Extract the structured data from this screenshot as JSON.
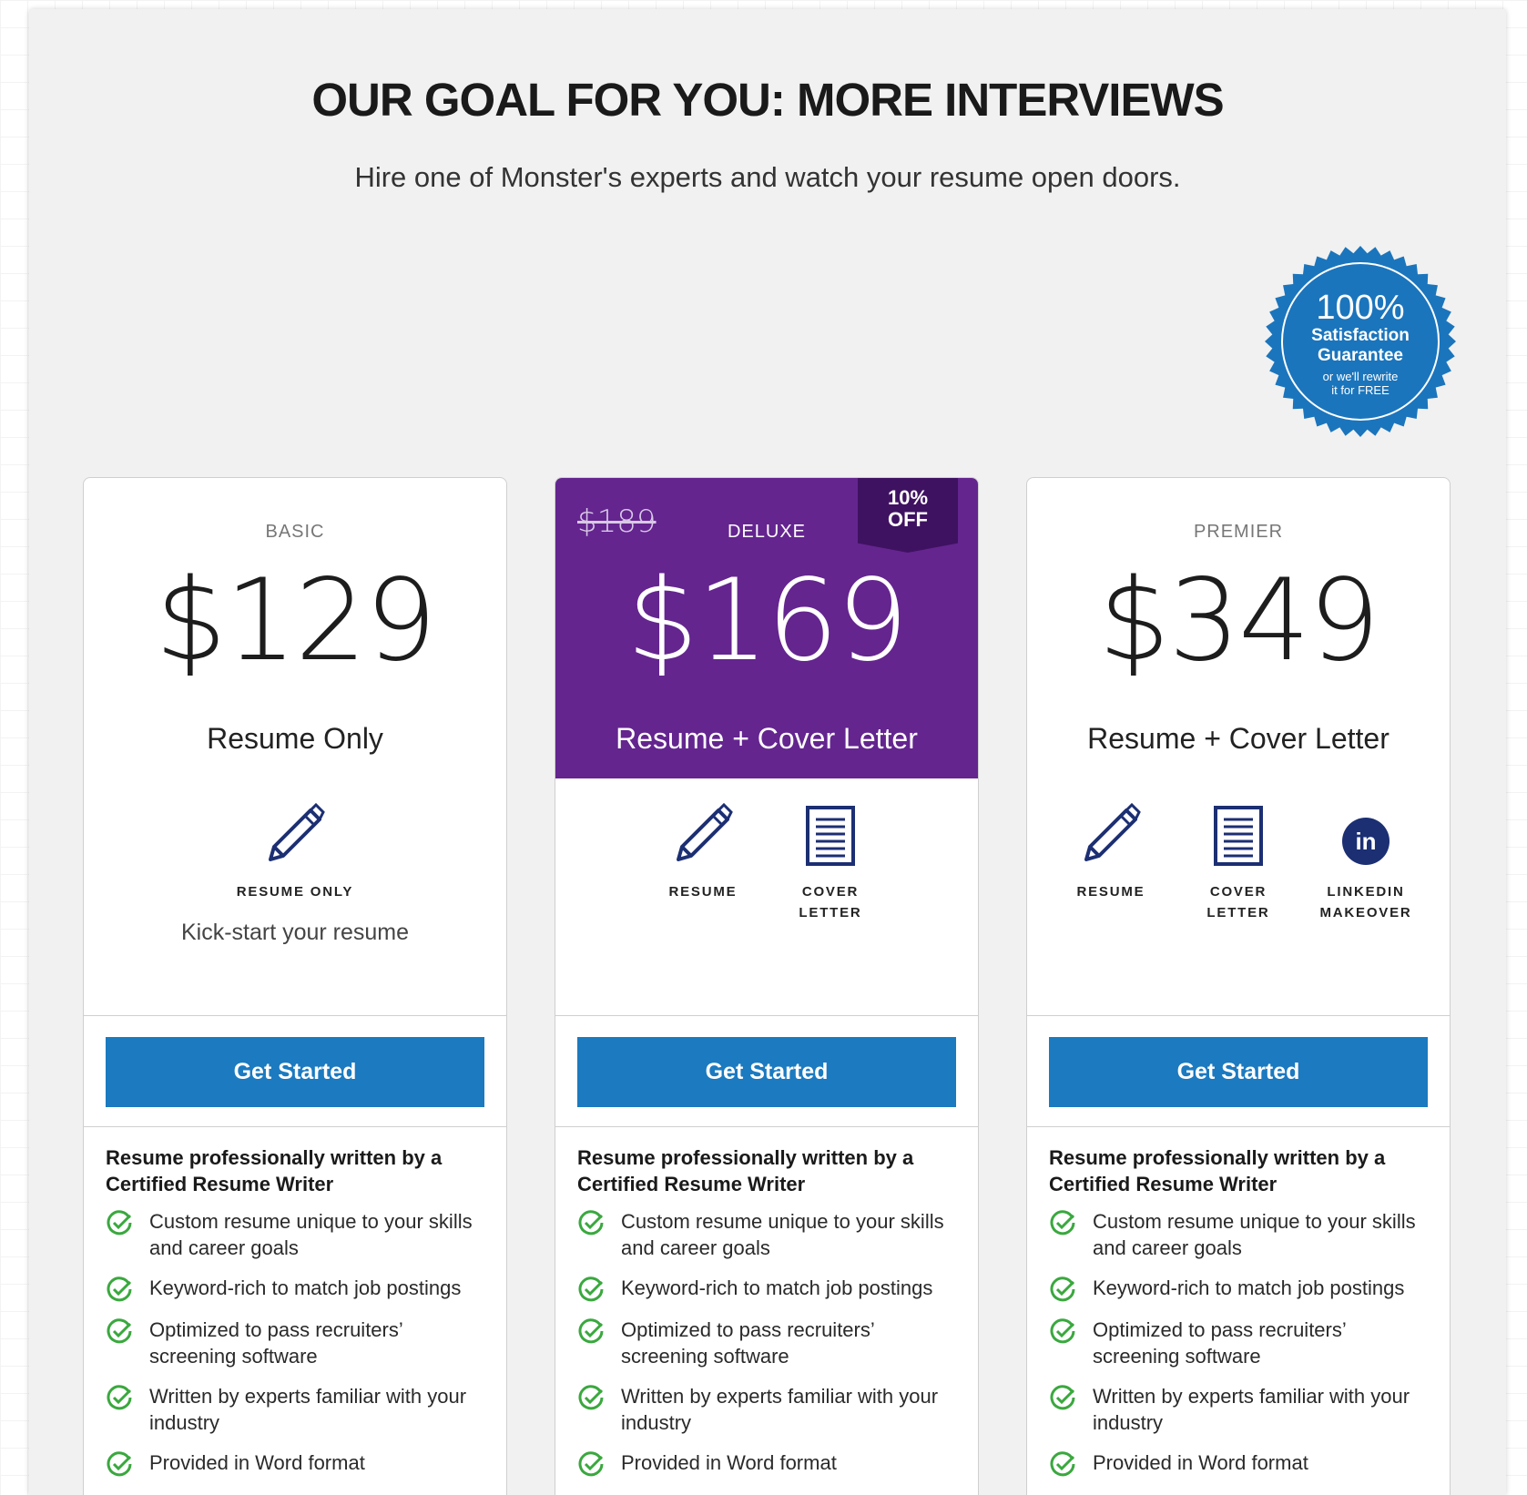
{
  "header": {
    "title": "OUR GOAL FOR YOU: MORE INTERVIEWS",
    "subtitle": "Hire one of Monster's experts and watch your resume open doors."
  },
  "seal": {
    "percent": "100%",
    "line1": "Satisfaction",
    "line2": "Guarantee",
    "small1": "or we'll rewrite",
    "small2": "it for FREE",
    "color": "#1b75bc"
  },
  "colors": {
    "accent_purple": "#64258f",
    "badge_purple": "#3f1261",
    "cta_blue": "#1b7ac0",
    "icon_navy": "#1c2f73",
    "check_green": "#3aa83e"
  },
  "plans": [
    {
      "tier": "BASIC",
      "price": "$129",
      "name": "Resume Only",
      "features": [
        {
          "icon": "pen-icon",
          "label": "RESUME ONLY"
        }
      ],
      "tagline": "Kick-start your resume",
      "cta": "Get Started",
      "list_heading": "Resume professionally written by a Certified Resume Writer",
      "bullets": [
        "Custom resume unique to your skills and career goals",
        "Keyword-rich to match job postings",
        "Optimized to pass recruiters’ screening software",
        "Written by experts familiar with your industry",
        "Provided in Word format"
      ]
    },
    {
      "tier": "DELUXE",
      "old_price": "$189",
      "discount_line1": "10%",
      "discount_line2": "OFF",
      "price": "$169",
      "name": "Resume + Cover Letter",
      "features": [
        {
          "icon": "pen-icon",
          "label_line1": "RESUME",
          "label_line2": ""
        },
        {
          "icon": "document-icon",
          "label_line1": "COVER",
          "label_line2": "LETTER"
        }
      ],
      "cta": "Get Started",
      "list_heading": "Resume professionally written by a Certified Resume Writer",
      "bullets": [
        "Custom resume unique to your skills and career goals",
        "Keyword-rich to match job postings",
        "Optimized to pass recruiters’ screening software",
        "Written by experts familiar with your industry",
        "Provided in Word format"
      ]
    },
    {
      "tier": "PREMIER",
      "price": "$349",
      "name": "Resume + Cover Letter",
      "features": [
        {
          "icon": "pen-icon",
          "label_line1": "RESUME",
          "label_line2": ""
        },
        {
          "icon": "document-icon",
          "label_line1": "COVER",
          "label_line2": "LETTER"
        },
        {
          "icon": "linkedin-icon",
          "label_line1": "LINKEDIN",
          "label_line2": "MAKEOVER",
          "glyph": "in"
        }
      ],
      "cta": "Get Started",
      "list_heading": "Resume professionally written by a Certified Resume Writer",
      "bullets": [
        "Custom resume unique to your skills and career goals",
        "Keyword-rich to match job postings",
        "Optimized to pass recruiters’ screening software",
        "Written by experts familiar with your industry",
        "Provided in Word format"
      ]
    }
  ]
}
